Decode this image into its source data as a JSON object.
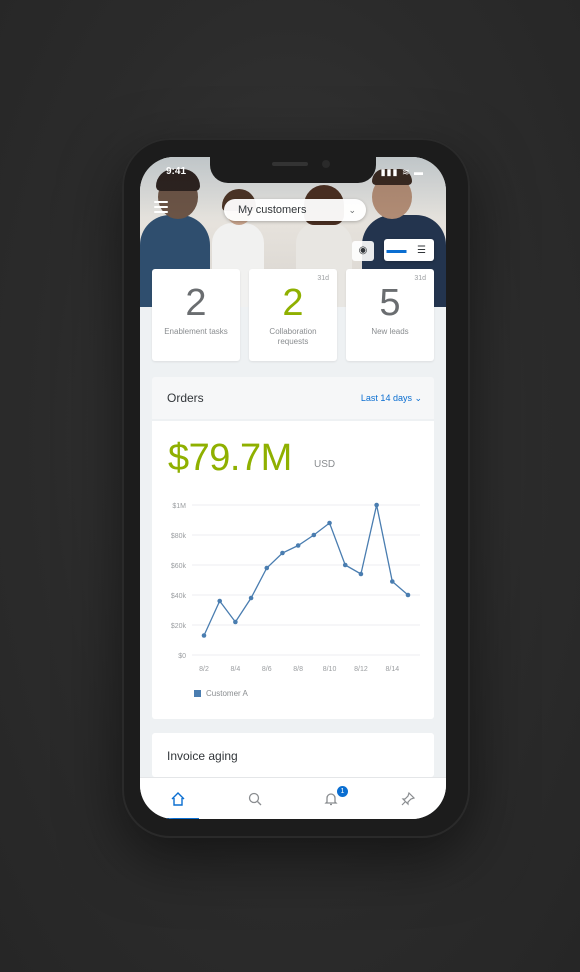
{
  "status_bar": {
    "time": "9:41",
    "icons": "▮▮▮ ≋ ▬"
  },
  "header": {
    "dropdown_label": "My customers",
    "toggle": {
      "left": "▬▬",
      "right": "☰"
    }
  },
  "kpis": [
    {
      "value": "2",
      "label": "Enablement tasks",
      "badge": ""
    },
    {
      "value": "2",
      "label": "Collaboration requests",
      "badge": "31d"
    },
    {
      "value": "5",
      "label": "New leads",
      "badge": "31d"
    }
  ],
  "orders": {
    "title": "Orders",
    "filter": "Last 14 days ⌄",
    "amount": "$79.7M",
    "currency": "USD"
  },
  "chart_data": {
    "type": "line",
    "y_tick_labels": [
      "$0",
      "$20k",
      "$40k",
      "$60k",
      "$80k",
      "$1M"
    ],
    "x_tick_labels": [
      "8/2",
      "8/4",
      "8/6",
      "8/8",
      "8/10",
      "8/12",
      "8/14"
    ],
    "ylim": [
      0,
      100
    ],
    "x": [
      "8/2",
      "8/3",
      "8/4",
      "8/5",
      "8/6",
      "8/7",
      "8/8",
      "8/9",
      "8/10",
      "8/11",
      "8/12",
      "8/13",
      "8/14",
      "8/15"
    ],
    "series": [
      {
        "name": "Customer A",
        "values": [
          13,
          36,
          22,
          38,
          58,
          68,
          73,
          80,
          88,
          60,
          54,
          100,
          49,
          40
        ]
      }
    ],
    "grid": true,
    "legend_position": "bottom-left"
  },
  "colors": {
    "accent": "#0a6ed1",
    "kpi_green": "#8fb000",
    "line": "#4a7db0"
  },
  "invoice": {
    "title": "Invoice aging"
  },
  "tabs": [
    {
      "icon": "home-icon",
      "active": true
    },
    {
      "icon": "search-icon",
      "active": false
    },
    {
      "icon": "bell-icon",
      "active": false,
      "count": "1"
    },
    {
      "icon": "pin-icon",
      "active": false
    }
  ]
}
